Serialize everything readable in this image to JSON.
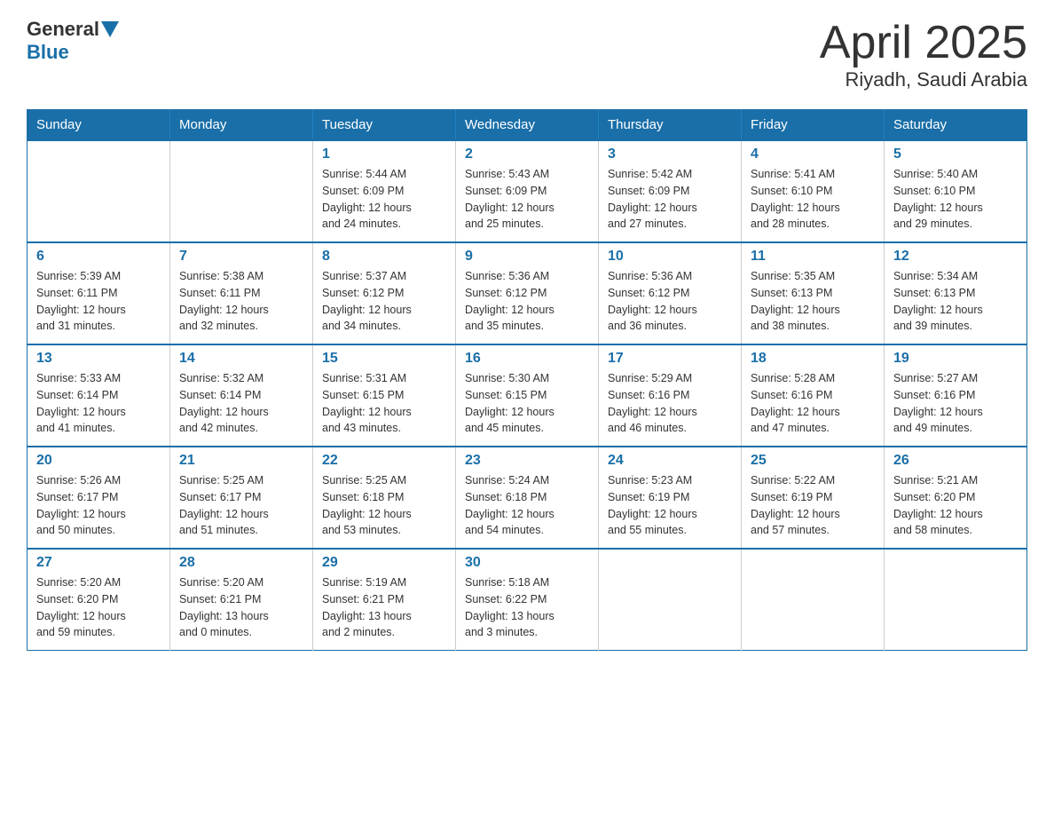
{
  "logo": {
    "general": "General",
    "blue": "Blue"
  },
  "title": "April 2025",
  "subtitle": "Riyadh, Saudi Arabia",
  "days_of_week": [
    "Sunday",
    "Monday",
    "Tuesday",
    "Wednesday",
    "Thursday",
    "Friday",
    "Saturday"
  ],
  "weeks": [
    [
      {
        "day": "",
        "info": ""
      },
      {
        "day": "",
        "info": ""
      },
      {
        "day": "1",
        "info": "Sunrise: 5:44 AM\nSunset: 6:09 PM\nDaylight: 12 hours\nand 24 minutes."
      },
      {
        "day": "2",
        "info": "Sunrise: 5:43 AM\nSunset: 6:09 PM\nDaylight: 12 hours\nand 25 minutes."
      },
      {
        "day": "3",
        "info": "Sunrise: 5:42 AM\nSunset: 6:09 PM\nDaylight: 12 hours\nand 27 minutes."
      },
      {
        "day": "4",
        "info": "Sunrise: 5:41 AM\nSunset: 6:10 PM\nDaylight: 12 hours\nand 28 minutes."
      },
      {
        "day": "5",
        "info": "Sunrise: 5:40 AM\nSunset: 6:10 PM\nDaylight: 12 hours\nand 29 minutes."
      }
    ],
    [
      {
        "day": "6",
        "info": "Sunrise: 5:39 AM\nSunset: 6:11 PM\nDaylight: 12 hours\nand 31 minutes."
      },
      {
        "day": "7",
        "info": "Sunrise: 5:38 AM\nSunset: 6:11 PM\nDaylight: 12 hours\nand 32 minutes."
      },
      {
        "day": "8",
        "info": "Sunrise: 5:37 AM\nSunset: 6:12 PM\nDaylight: 12 hours\nand 34 minutes."
      },
      {
        "day": "9",
        "info": "Sunrise: 5:36 AM\nSunset: 6:12 PM\nDaylight: 12 hours\nand 35 minutes."
      },
      {
        "day": "10",
        "info": "Sunrise: 5:36 AM\nSunset: 6:12 PM\nDaylight: 12 hours\nand 36 minutes."
      },
      {
        "day": "11",
        "info": "Sunrise: 5:35 AM\nSunset: 6:13 PM\nDaylight: 12 hours\nand 38 minutes."
      },
      {
        "day": "12",
        "info": "Sunrise: 5:34 AM\nSunset: 6:13 PM\nDaylight: 12 hours\nand 39 minutes."
      }
    ],
    [
      {
        "day": "13",
        "info": "Sunrise: 5:33 AM\nSunset: 6:14 PM\nDaylight: 12 hours\nand 41 minutes."
      },
      {
        "day": "14",
        "info": "Sunrise: 5:32 AM\nSunset: 6:14 PM\nDaylight: 12 hours\nand 42 minutes."
      },
      {
        "day": "15",
        "info": "Sunrise: 5:31 AM\nSunset: 6:15 PM\nDaylight: 12 hours\nand 43 minutes."
      },
      {
        "day": "16",
        "info": "Sunrise: 5:30 AM\nSunset: 6:15 PM\nDaylight: 12 hours\nand 45 minutes."
      },
      {
        "day": "17",
        "info": "Sunrise: 5:29 AM\nSunset: 6:16 PM\nDaylight: 12 hours\nand 46 minutes."
      },
      {
        "day": "18",
        "info": "Sunrise: 5:28 AM\nSunset: 6:16 PM\nDaylight: 12 hours\nand 47 minutes."
      },
      {
        "day": "19",
        "info": "Sunrise: 5:27 AM\nSunset: 6:16 PM\nDaylight: 12 hours\nand 49 minutes."
      }
    ],
    [
      {
        "day": "20",
        "info": "Sunrise: 5:26 AM\nSunset: 6:17 PM\nDaylight: 12 hours\nand 50 minutes."
      },
      {
        "day": "21",
        "info": "Sunrise: 5:25 AM\nSunset: 6:17 PM\nDaylight: 12 hours\nand 51 minutes."
      },
      {
        "day": "22",
        "info": "Sunrise: 5:25 AM\nSunset: 6:18 PM\nDaylight: 12 hours\nand 53 minutes."
      },
      {
        "day": "23",
        "info": "Sunrise: 5:24 AM\nSunset: 6:18 PM\nDaylight: 12 hours\nand 54 minutes."
      },
      {
        "day": "24",
        "info": "Sunrise: 5:23 AM\nSunset: 6:19 PM\nDaylight: 12 hours\nand 55 minutes."
      },
      {
        "day": "25",
        "info": "Sunrise: 5:22 AM\nSunset: 6:19 PM\nDaylight: 12 hours\nand 57 minutes."
      },
      {
        "day": "26",
        "info": "Sunrise: 5:21 AM\nSunset: 6:20 PM\nDaylight: 12 hours\nand 58 minutes."
      }
    ],
    [
      {
        "day": "27",
        "info": "Sunrise: 5:20 AM\nSunset: 6:20 PM\nDaylight: 12 hours\nand 59 minutes."
      },
      {
        "day": "28",
        "info": "Sunrise: 5:20 AM\nSunset: 6:21 PM\nDaylight: 13 hours\nand 0 minutes."
      },
      {
        "day": "29",
        "info": "Sunrise: 5:19 AM\nSunset: 6:21 PM\nDaylight: 13 hours\nand 2 minutes."
      },
      {
        "day": "30",
        "info": "Sunrise: 5:18 AM\nSunset: 6:22 PM\nDaylight: 13 hours\nand 3 minutes."
      },
      {
        "day": "",
        "info": ""
      },
      {
        "day": "",
        "info": ""
      },
      {
        "day": "",
        "info": ""
      }
    ]
  ]
}
